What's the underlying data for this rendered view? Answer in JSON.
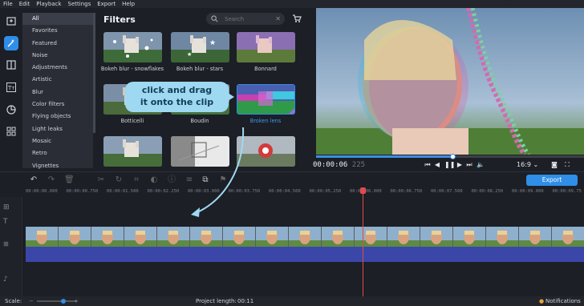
{
  "menu": [
    "File",
    "Edit",
    "Playback",
    "Settings",
    "Export",
    "Help"
  ],
  "panel": {
    "title": "Filters",
    "search_placeholder": "Search",
    "categories": [
      "All",
      "Favorites",
      "Featured",
      "Noise",
      "Adjustments",
      "Artistic",
      "Blur",
      "Color filters",
      "Flying objects",
      "Light leaks",
      "Mosaic",
      "Retro",
      "Vignettes"
    ],
    "selected_category": "All",
    "filters": [
      "Bokeh blur - snowflakes",
      "Bokeh blur - stars",
      "Bonnard",
      "Botticelli",
      "Boudin",
      "Broken lens",
      "",
      "",
      ""
    ],
    "selected_filter": "Broken lens"
  },
  "hint": {
    "line1": "click and drag",
    "line2": "it onto the clip"
  },
  "player": {
    "time": "00:00:06",
    "frames": "225",
    "aspect": "16:9",
    "progress_fraction": 0.51
  },
  "toolbar": {
    "export_label": "Export"
  },
  "ruler": [
    "00:00:00.000",
    "00:00:00.750",
    "00:00:01.500",
    "00:00:02.250",
    "00:00:03.000",
    "00:00:03.750",
    "00:00:04.500",
    "00:00:05.250",
    "00:00:06.000",
    "00:00:06.750",
    "00:00:07.500",
    "00:00:08.250",
    "00:00:09.000",
    "00:00:09.75"
  ],
  "status": {
    "scale_label": "Scale:",
    "project_length_label": "Project length:",
    "project_length_value": "00:11",
    "notifications": "Notifications"
  },
  "colors": {
    "accent": "#2f8ee8",
    "playhead": "#e04b4b",
    "audio_clip": "#3a47a9",
    "hint_bubble": "#9ed8f1"
  }
}
